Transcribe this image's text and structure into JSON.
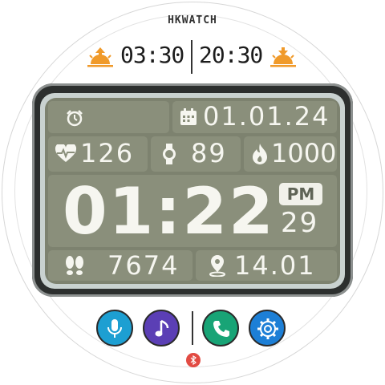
{
  "brand": "HKWATCH",
  "sun": {
    "sunrise": "03:30",
    "sunset": "20:30"
  },
  "panel": {
    "date": "01.01.24",
    "heart_rate": "126",
    "stress": "89",
    "calories": "1000",
    "time": "01:22",
    "ampm": "PM",
    "seconds": "29",
    "steps": "7674",
    "distance": "14.01"
  },
  "icons": {
    "alarm": "alarm-clock-icon",
    "calendar": "calendar-icon",
    "heart": "heart-pulse-icon",
    "watch": "watch-icon",
    "flame": "flame-icon",
    "footprints": "footprints-icon",
    "location": "location-pin-icon",
    "bluetooth": "bluetooth-icon"
  },
  "buttons": [
    {
      "name": "voice-assistant",
      "icon": "microphone-icon",
      "color": "#1d9fd2"
    },
    {
      "name": "music",
      "icon": "music-note-icon",
      "color": "#5b3fb5"
    },
    {
      "name": "phone",
      "icon": "phone-icon",
      "color": "#18a476"
    },
    {
      "name": "settings",
      "icon": "gear-icon",
      "color": "#1d7fd6"
    }
  ],
  "colors": {
    "lcd_bg": "#7d826f",
    "lcd_text": "#f6f6f0",
    "sun_orange": "#f09a2a",
    "bluetooth_red": "#e24b43"
  }
}
